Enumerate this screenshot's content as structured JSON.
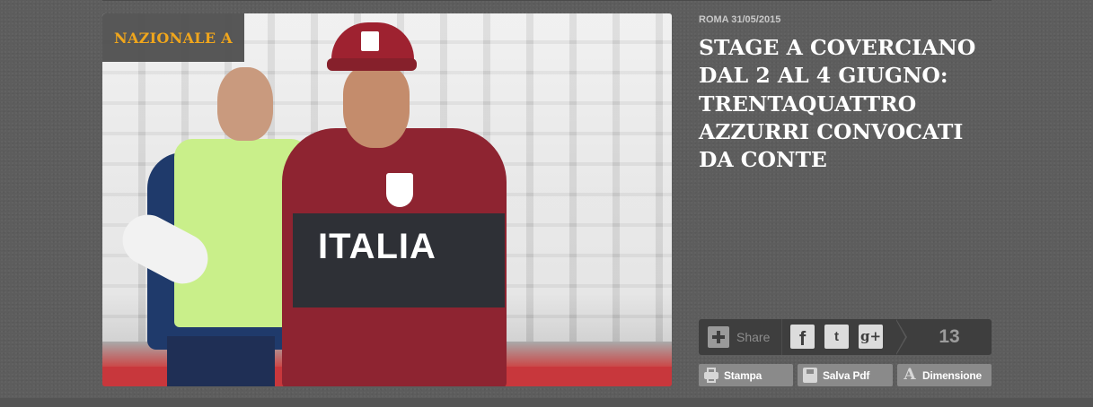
{
  "article": {
    "category": "NAZIONALE A",
    "meta": "ROMA 31/05/2015",
    "headline": "STAGE A COVERCIANO DAL 2 AL 4 GIUGNO: TRENTAQUATTRO AZZURRI CONVOCATI DA CONTE",
    "photo_jacket_text": "ITALIA"
  },
  "share": {
    "label": "Share",
    "facebook": "f",
    "twitter": "t",
    "gplus": "g+",
    "count": "13",
    "icons": [
      "plus-icon",
      "facebook-icon",
      "twitter-icon",
      "google-plus-icon"
    ]
  },
  "tools": {
    "print": "Stampa",
    "save_pdf": "Salva Pdf",
    "font_size": "Dimensione"
  },
  "colors": {
    "background": "#5d5d5d",
    "category_text": "#f0a61c",
    "headline": "#ffffff",
    "share_bar": "#3e3e3e",
    "tool_button": "#8a8a8a"
  }
}
